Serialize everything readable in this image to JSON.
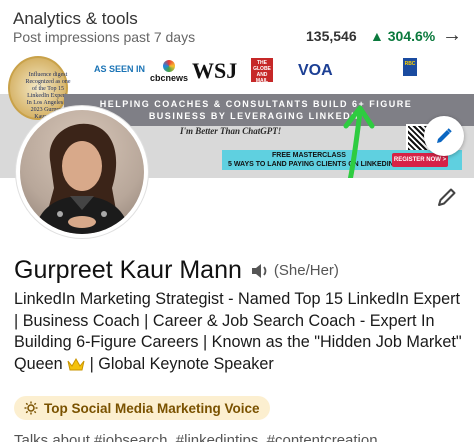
{
  "analytics": {
    "title": "Analytics & tools",
    "subtitle": "Post impressions past 7 days",
    "impressions": "135,546",
    "change": "▲ 304.6%"
  },
  "banner": {
    "award_text": "Influence digest Recognized as one of the Top 15 LinkedIn Experts In Los Angeles in 2023 Gurpreet Kaur Mann",
    "seen_in": "AS SEEN IN",
    "logos": {
      "cbc": "cbcnews",
      "wsj": "WSJ",
      "globe": "THE GLOBE AND MAIL",
      "voa": "VOA",
      "rbc": "RBC"
    },
    "strip_line1": "HELPING COACHES & CONSULTANTS BUILD 6+ FIGURE",
    "strip_line2": "BUSINESS BY LEVERAGING LINKEDIN",
    "quote": "I'm Better Than ChatGPT!",
    "cta_title": "FREE MASTERCLASS",
    "cta_sub": "5 WAYS TO LAND PAYING CLIENTS ON LINKEDIN",
    "register": "REGISTER NOW >"
  },
  "profile": {
    "name": "Gurpreet Kaur Mann",
    "pronouns": "(She/Her)",
    "headline_part1": "LinkedIn Marketing Strategist - Named Top 15 LinkedIn Expert |  Business Coach  | Career & Job Search Coach - Expert In Building 6-Figure Careers | Known as the \"Hidden Job Market\" Queen ",
    "headline_part2": " | Global Keynote Speaker",
    "voice_badge": "Top Social Media Marketing Voice",
    "talks_about": "Talks about #jobsearch, #linkedintips, #contentcreation"
  },
  "colors": {
    "positive": "#0b7a3d",
    "badge_bg": "#fcefd0",
    "arrow_green": "#2ecc40"
  },
  "icons": [
    "arrow-right-icon",
    "edit-pencil-icon",
    "speaker-icon",
    "crown-icon",
    "sun-badge-icon"
  ]
}
